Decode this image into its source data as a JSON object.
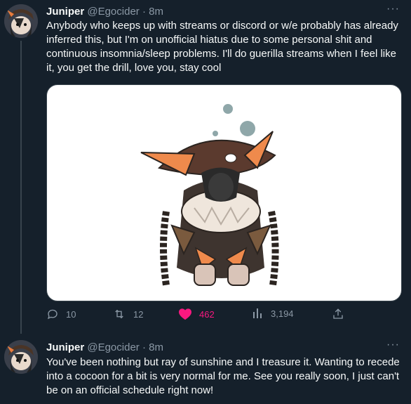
{
  "tweets": [
    {
      "author": "Juniper",
      "handle": "@Egocider",
      "separator": "·",
      "time": "8m",
      "text": "Anybody who keeps up with streams or discord or w/e probably has already inferred this, but I'm on unofficial hiatus due to some personal shit and continuous insomnia/sleep problems. I'll do guerilla streams when I feel like it, you get the drill, love you, stay cool",
      "more": "···",
      "media_icon": "character-drawing-image",
      "actions": {
        "replies": "10",
        "retweets": "12",
        "likes": "462",
        "views": "3,194"
      }
    },
    {
      "author": "Juniper",
      "handle": "@Egocider",
      "separator": "·",
      "time": "8m",
      "text": "You've been nothing but ray of sunshine and I treasure it. Wanting to recede into a cocoon for a bit is very normal for me. See you really soon, I just can't be on an official schedule right now!",
      "more": "···"
    }
  ],
  "colors": {
    "background": "#15202b",
    "secondary_text": "#8b98a5",
    "like": "#f91880",
    "line": "#38444d"
  }
}
